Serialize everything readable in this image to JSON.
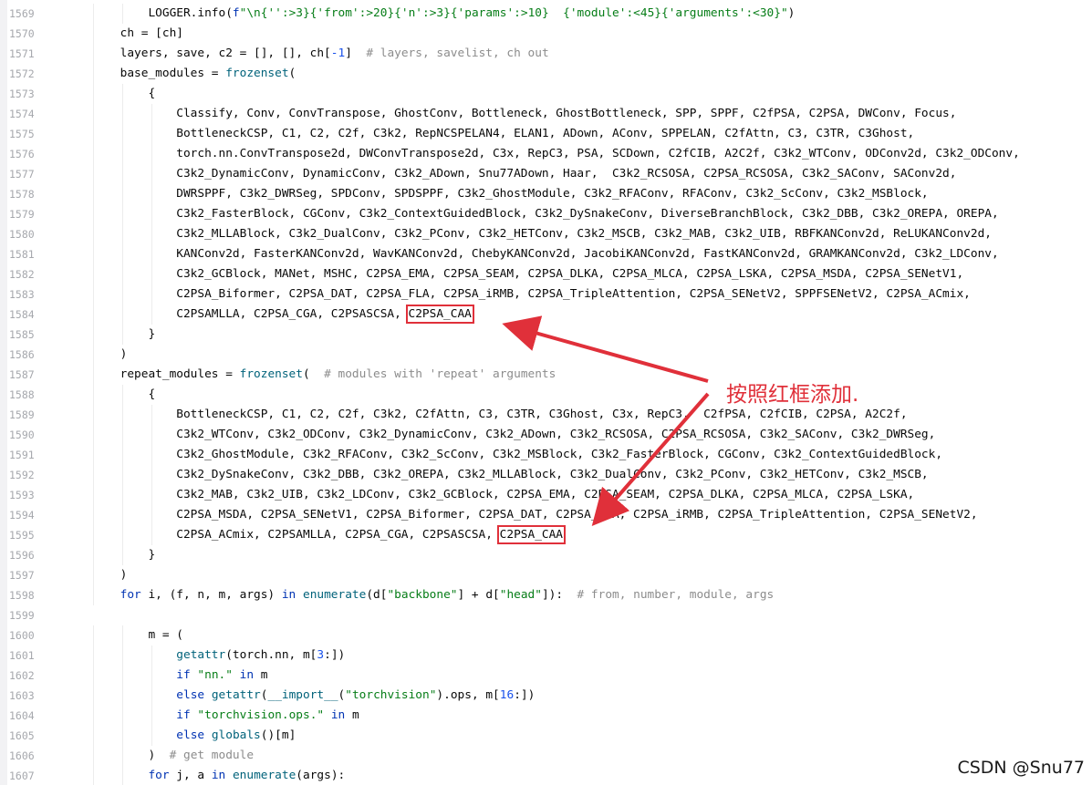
{
  "editor": {
    "lines": [
      {
        "no": "1569",
        "tokens": [
          [
            "plain",
            "            LOGGER.info("
          ],
          [
            "kw",
            "f"
          ],
          [
            "str",
            "\"\\n{"
          ],
          [
            "str",
            "'':>3"
          ],
          [
            "str",
            "}{"
          ],
          [
            "str",
            "'from'"
          ],
          [
            "str",
            ":>20}{"
          ],
          [
            "str",
            "'n'"
          ],
          [
            "str",
            ":>3}{"
          ],
          [
            "str",
            "'params'"
          ],
          [
            "str",
            ":>10}  {"
          ],
          [
            "str",
            "'module'"
          ],
          [
            "str",
            ":<45}{"
          ],
          [
            "str",
            "'arguments'"
          ],
          [
            "str",
            ":<30}\""
          ],
          [
            "plain",
            ")"
          ]
        ]
      },
      {
        "no": "1570",
        "tokens": [
          [
            "plain",
            "        ch = [ch]"
          ]
        ]
      },
      {
        "no": "1571",
        "tokens": [
          [
            "plain",
            "        layers, save, c2 = [], [], ch["
          ],
          [
            "num",
            "-1"
          ],
          [
            "plain",
            "]  "
          ],
          [
            "cm",
            "# layers, savelist, ch out"
          ]
        ]
      },
      {
        "no": "1572",
        "tokens": [
          [
            "plain",
            "        base_modules = "
          ],
          [
            "fn",
            "frozenset"
          ],
          [
            "plain",
            "("
          ]
        ]
      },
      {
        "no": "1573",
        "tokens": [
          [
            "plain",
            "            {"
          ]
        ]
      },
      {
        "no": "1574",
        "tokens": [
          [
            "plain",
            "                Classify, Conv, ConvTranspose, GhostConv, Bottleneck, GhostBottleneck, SPP, SPPF, C2fPSA, C2PSA, DWConv, Focus,"
          ]
        ]
      },
      {
        "no": "1575",
        "tokens": [
          [
            "plain",
            "                BottleneckCSP, C1, C2, C2f, C3k2, RepNCSPELAN4, ELAN1, ADown, AConv, SPPELAN, C2fAttn, C3, C3TR, C3Ghost,"
          ]
        ]
      },
      {
        "no": "1576",
        "tokens": [
          [
            "plain",
            "                torch.nn.ConvTranspose2d, DWConvTranspose2d, C3x, RepC3, PSA, SCDown, C2fCIB, A2C2f, C3k2_WTConv, ODConv2d, C3k2_ODConv,"
          ]
        ]
      },
      {
        "no": "1577",
        "tokens": [
          [
            "plain",
            "                C3k2_DynamicConv, DynamicConv, C3k2_ADown, Snu77ADown, Haar,  C3k2_RCSOSA, C2PSA_RCSOSA, C3k2_SAConv, SAConv2d,"
          ]
        ]
      },
      {
        "no": "1578",
        "tokens": [
          [
            "plain",
            "                DWRSPPF, C3k2_DWRSeg, SPDConv, SPDSPPF, C3k2_GhostModule, C3k2_RFAConv, RFAConv, C3k2_ScConv, C3k2_MSBlock,"
          ]
        ]
      },
      {
        "no": "1579",
        "tokens": [
          [
            "plain",
            "                C3k2_FasterBlock, CGConv, C3k2_ContextGuidedBlock, C3k2_DySnakeConv, DiverseBranchBlock, C3k2_DBB, C3k2_OREPA, OREPA,"
          ]
        ]
      },
      {
        "no": "1580",
        "tokens": [
          [
            "plain",
            "                C3k2_MLLABlock, C3k2_DualConv, C3k2_PConv, C3k2_HETConv, C3k2_MSCB, C3k2_MAB, C3k2_UIB, RBFKANConv2d, ReLUKANConv2d,"
          ]
        ]
      },
      {
        "no": "1581",
        "tokens": [
          [
            "plain",
            "                KANConv2d, FasterKANConv2d, WavKANConv2d, ChebyKANConv2d, JacobiKANConv2d, FastKANConv2d, GRAMKANConv2d, C3k2_LDConv,"
          ]
        ]
      },
      {
        "no": "1582",
        "tokens": [
          [
            "plain",
            "                C3k2_GCBlock, MANet, MSHC, C2PSA_EMA, C2PSA_SEAM, C2PSA_DLKA, C2PSA_MLCA, C2PSA_LSKA, C2PSA_MSDA, C2PSA_SENetV1,"
          ]
        ]
      },
      {
        "no": "1583",
        "tokens": [
          [
            "plain",
            "                C2PSA_Biformer, C2PSA_DAT, C2PSA_FLA, C2PSA_iRMB, C2PSA_TripleAttention, C2PSA_SENetV2, SPPFSENetV2, C2PSA_ACmix,"
          ]
        ]
      },
      {
        "no": "1584",
        "tokens": [
          [
            "plain",
            "                C2PSAMLLA, C2PSA_CGA, C2PSASCSA, "
          ],
          [
            "hl",
            "C2PSA_CAA"
          ]
        ]
      },
      {
        "no": "1585",
        "tokens": [
          [
            "plain",
            "            }"
          ]
        ]
      },
      {
        "no": "1586",
        "tokens": [
          [
            "plain",
            "        )"
          ]
        ]
      },
      {
        "no": "1587",
        "tokens": [
          [
            "plain",
            "        repeat_modules = "
          ],
          [
            "fn",
            "frozenset"
          ],
          [
            "plain",
            "(  "
          ],
          [
            "cm",
            "# modules with 'repeat' arguments"
          ]
        ]
      },
      {
        "no": "1588",
        "tokens": [
          [
            "plain",
            "            {"
          ]
        ]
      },
      {
        "no": "1589",
        "tokens": [
          [
            "plain",
            "                BottleneckCSP, C1, C2, C2f, C3k2, C2fAttn, C3, C3TR, C3Ghost, C3x, RepC3,  C2fPSA, C2fCIB, C2PSA, A2C2f,"
          ]
        ]
      },
      {
        "no": "1590",
        "tokens": [
          [
            "plain",
            "                C3k2_WTConv, C3k2_ODConv, C3k2_DynamicConv, C3k2_ADown, C3k2_RCSOSA, C2PSA_RCSOSA, C3k2_SAConv, C3k2_DWRSeg,"
          ]
        ]
      },
      {
        "no": "1591",
        "tokens": [
          [
            "plain",
            "                C3k2_GhostModule, C3k2_RFAConv, C3k2_ScConv, C3k2_MSBlock, C3k2_FasterBlock, CGConv, C3k2_ContextGuidedBlock,"
          ]
        ]
      },
      {
        "no": "1592",
        "tokens": [
          [
            "plain",
            "                C3k2_DySnakeConv, C3k2_DBB, C3k2_OREPA, C3k2_MLLABlock, C3k2_DualConv, C3k2_PConv, C3k2_HETConv, C3k2_MSCB,"
          ]
        ]
      },
      {
        "no": "1593",
        "tokens": [
          [
            "plain",
            "                C3k2_MAB, C3k2_UIB, C3k2_LDConv, C3k2_GCBlock, C2PSA_EMA, C2PSA_SEAM, C2PSA_DLKA, C2PSA_MLCA, C2PSA_LSKA,"
          ]
        ]
      },
      {
        "no": "1594",
        "tokens": [
          [
            "plain",
            "                C2PSA_MSDA, C2PSA_SENetV1, C2PSA_Biformer, C2PSA_DAT, C2PSA_FLA, C2PSA_iRMB, C2PSA_TripleAttention, C2PSA_SENetV2,"
          ]
        ]
      },
      {
        "no": "1595",
        "tokens": [
          [
            "plain",
            "                C2PSA_ACmix, C2PSAMLLA, C2PSA_CGA, C2PSASCSA, "
          ],
          [
            "hl",
            "C2PSA_CAA"
          ]
        ]
      },
      {
        "no": "1596",
        "tokens": [
          [
            "plain",
            "            }"
          ]
        ]
      },
      {
        "no": "1597",
        "tokens": [
          [
            "plain",
            "        )"
          ]
        ]
      },
      {
        "no": "1598",
        "tokens": [
          [
            "kw",
            "        for"
          ],
          [
            "plain",
            " i, (f, n, m, args) "
          ],
          [
            "kw",
            "in"
          ],
          [
            "plain",
            " "
          ],
          [
            "fn",
            "enumerate"
          ],
          [
            "plain",
            "(d["
          ],
          [
            "str",
            "\"backbone\""
          ],
          [
            "plain",
            "] + d["
          ],
          [
            "str",
            "\"head\""
          ],
          [
            "plain",
            "]):  "
          ],
          [
            "cm",
            "# from, number, module, args"
          ]
        ]
      },
      {
        "no": "1599",
        "tokens": [
          [
            "plain",
            ""
          ]
        ]
      },
      {
        "no": "1600",
        "tokens": [
          [
            "plain",
            "            m = ("
          ]
        ]
      },
      {
        "no": "1601",
        "tokens": [
          [
            "plain",
            "                "
          ],
          [
            "fn",
            "getattr"
          ],
          [
            "plain",
            "(torch.nn, m["
          ],
          [
            "num",
            "3"
          ],
          [
            "plain",
            ":])"
          ]
        ]
      },
      {
        "no": "1602",
        "tokens": [
          [
            "plain",
            "                "
          ],
          [
            "kw",
            "if"
          ],
          [
            "plain",
            " "
          ],
          [
            "str",
            "\"nn.\""
          ],
          [
            "plain",
            " "
          ],
          [
            "kw",
            "in"
          ],
          [
            "plain",
            " m"
          ]
        ]
      },
      {
        "no": "1603",
        "tokens": [
          [
            "plain",
            "                "
          ],
          [
            "kw",
            "else"
          ],
          [
            "plain",
            " "
          ],
          [
            "fn",
            "getattr"
          ],
          [
            "plain",
            "("
          ],
          [
            "fn",
            "__import__"
          ],
          [
            "plain",
            "("
          ],
          [
            "str",
            "\"torchvision\""
          ],
          [
            "plain",
            ").ops, m["
          ],
          [
            "num",
            "16"
          ],
          [
            "plain",
            ":])"
          ]
        ]
      },
      {
        "no": "1604",
        "tokens": [
          [
            "plain",
            "                "
          ],
          [
            "kw",
            "if"
          ],
          [
            "plain",
            " "
          ],
          [
            "str",
            "\"torchvision.ops.\""
          ],
          [
            "plain",
            " "
          ],
          [
            "kw",
            "in"
          ],
          [
            "plain",
            " m"
          ]
        ]
      },
      {
        "no": "1605",
        "tokens": [
          [
            "plain",
            "                "
          ],
          [
            "kw",
            "else"
          ],
          [
            "plain",
            " "
          ],
          [
            "fn",
            "globals"
          ],
          [
            "plain",
            "()[m]"
          ]
        ]
      },
      {
        "no": "1606",
        "tokens": [
          [
            "plain",
            "            )  "
          ],
          [
            "cm",
            "# get module"
          ]
        ]
      },
      {
        "no": "1607",
        "tokens": [
          [
            "kw",
            "            for"
          ],
          [
            "plain",
            " j, a "
          ],
          [
            "kw",
            "in"
          ],
          [
            "plain",
            " "
          ],
          [
            "fn",
            "enumerate"
          ],
          [
            "plain",
            "(args):"
          ]
        ]
      }
    ]
  },
  "annotation": {
    "text": "按照红框添加.",
    "color": "#e0303a"
  },
  "watermark": "CSDN @Snu77"
}
